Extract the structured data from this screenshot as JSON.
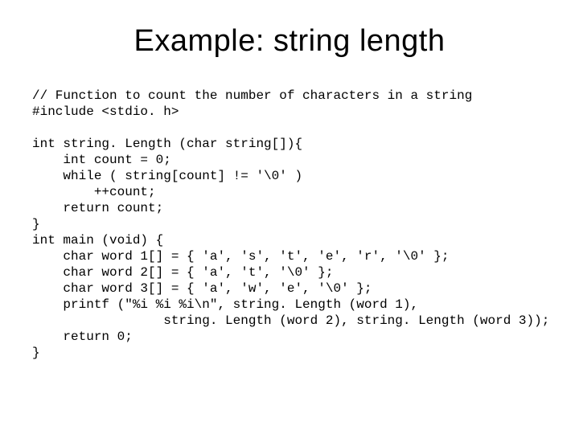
{
  "title": "Example: string length",
  "code_lines": [
    "// Function to count the number of characters in a string",
    "#include <stdio. h>",
    "",
    "int string. Length (char string[]){",
    "    int count = 0;",
    "    while ( string[count] != '\\0' )",
    "        ++count;",
    "    return count;",
    "}",
    "int main (void) {",
    "    char word 1[] = { 'a', 's', 't', 'e', 'r', '\\0' };",
    "    char word 2[] = { 'a', 't', '\\0' };",
    "    char word 3[] = { 'a', 'w', 'e', '\\0' };",
    "    printf (\"%i %i %i\\n\", string. Length (word 1),",
    "                 string. Length (word 2), string. Length (word 3));",
    "    return 0;",
    "}"
  ]
}
